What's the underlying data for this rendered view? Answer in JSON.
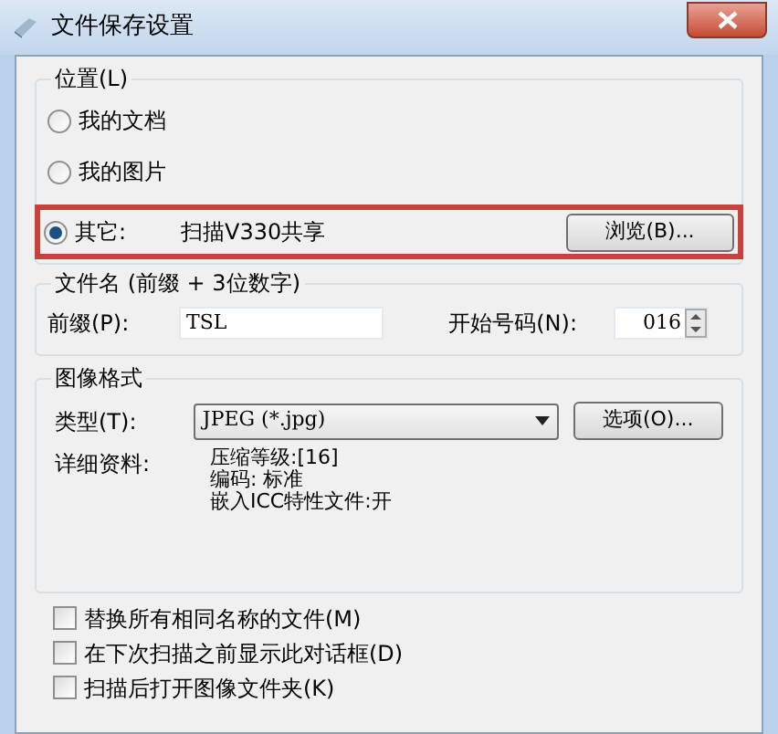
{
  "window": {
    "title": "文件保存设置"
  },
  "location": {
    "label": "位置(L)",
    "options": [
      {
        "label": "我的文档",
        "selected": false
      },
      {
        "label": "我的图片",
        "selected": false
      },
      {
        "label": "其它:",
        "selected": true,
        "path": "扫描V330共享",
        "highlighted": true
      }
    ],
    "browse_button": "浏览(B)..."
  },
  "file_name": {
    "label": "文件名 (前缀 + 3位数字)",
    "prefix_label": "前缀(P):",
    "prefix_value": "TSL",
    "start_label": "开始号码(N):",
    "start_value": "016"
  },
  "image_format": {
    "label": "图像格式",
    "type_label": "类型(T):",
    "type_value": "JPEG (*.jpg)",
    "options_button": "选项(O)...",
    "details_label": "详细资料:",
    "details": [
      "压缩等级:[16]",
      "编码: 标准",
      "嵌入ICC特性文件:开"
    ]
  },
  "checkboxes": [
    {
      "label": "替换所有相同名称的文件(M)",
      "checked": false
    },
    {
      "label": "在下次扫描之前显示此对话框(D)",
      "checked": false
    },
    {
      "label": "扫描后打开图像文件夹(K)",
      "checked": false
    }
  ]
}
